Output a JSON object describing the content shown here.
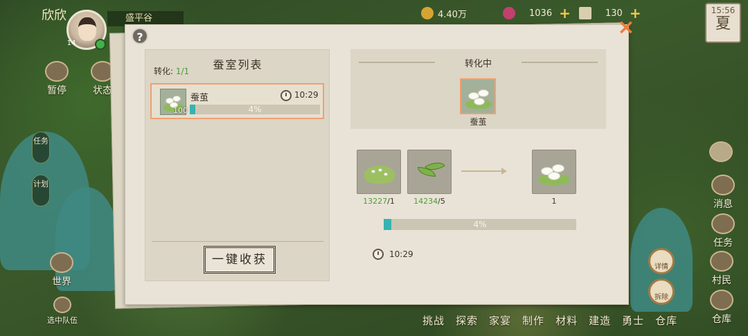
{
  "player": {
    "name": "欣欣",
    "level": "14",
    "location": "盛平谷"
  },
  "resources": [
    {
      "value": "4.40万",
      "color": "#d6a531"
    },
    {
      "value": "1036",
      "color": "#c2406e"
    },
    {
      "value": "130",
      "color": "#d9cfae"
    }
  ],
  "season": {
    "time": "15:56",
    "name": "夏"
  },
  "left_menu": {
    "pause": "暂停",
    "status": "状态",
    "tasks": "任务",
    "plan": "计划",
    "world": "世界",
    "select_team": "选中队伍"
  },
  "right_menu": {
    "messages": "消息",
    "tasks": "任务",
    "villagers": "村民",
    "warehouse": "仓库",
    "details": "详情",
    "demolish": "拆除"
  },
  "bottom_menu": [
    "挑战",
    "探索",
    "家宴",
    "制作",
    "材料",
    "建造",
    "勇士",
    "仓库"
  ],
  "modal": {
    "help_icon": "?",
    "close_icon": "×",
    "left": {
      "title": "蚕室列表",
      "convert_label": "转化:",
      "convert_count": "1/1",
      "item": {
        "name": "蚕茧",
        "qty": "100",
        "time": "10:29",
        "progress_label": "4%",
        "progress": 0.04
      },
      "harvest_button": "一键收获"
    },
    "right": {
      "status": "转化中",
      "product_name": "蚕茧",
      "inputs": [
        {
          "have": "13227",
          "need": "/1"
        },
        {
          "have": "14234",
          "need": "/5"
        }
      ],
      "output_count": "1",
      "progress_label": "4%",
      "progress": 0.04,
      "time": "10:29"
    }
  }
}
